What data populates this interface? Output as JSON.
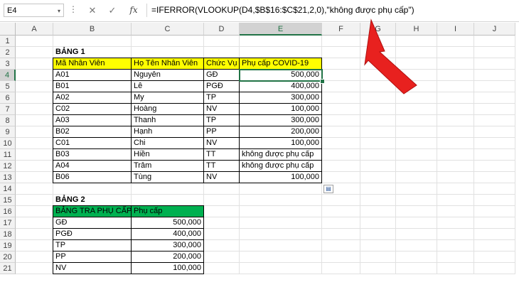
{
  "name_box": "E4",
  "name_box_arrow": "▾",
  "formula_bar": {
    "cancel": "✕",
    "enter": "✓",
    "fx": "fx",
    "formula": "=IFERROR(VLOOKUP(D4,$B$16:$C$21,2,0),\"không được phụ cấp\")"
  },
  "columns": [
    "A",
    "B",
    "C",
    "D",
    "E",
    "F",
    "G",
    "H",
    "I",
    "J"
  ],
  "rows": [
    "1",
    "2",
    "3",
    "4",
    "5",
    "6",
    "7",
    "8",
    "9",
    "10",
    "11",
    "12",
    "13",
    "14",
    "15",
    "16",
    "17",
    "18",
    "19",
    "20",
    "21"
  ],
  "selected_cell": "E4",
  "table1": {
    "title": "BẢNG 1",
    "headers": [
      "Mã Nhân Viên",
      "Họ Tên Nhân Viên",
      "Chức Vụ",
      "Phụ cấp COVID-19"
    ],
    "rows": [
      [
        "A01",
        "Nguyên",
        "GĐ",
        "500,000"
      ],
      [
        "B01",
        "Lê",
        "PGĐ",
        "400,000"
      ],
      [
        "A02",
        "My",
        "TP",
        "300,000"
      ],
      [
        "C02",
        "Hoàng",
        "NV",
        "100,000"
      ],
      [
        "A03",
        "Thanh",
        "TP",
        "300,000"
      ],
      [
        "B02",
        "Hạnh",
        "PP",
        "200,000"
      ],
      [
        "C01",
        "Chi",
        "NV",
        "100,000"
      ],
      [
        "B03",
        "Hiền",
        "TT",
        "không được phụ cấp"
      ],
      [
        "A04",
        "Trâm",
        "TT",
        "không được phụ cấp"
      ],
      [
        "B06",
        "Tùng",
        "NV",
        "100,000"
      ]
    ]
  },
  "table2": {
    "title": "BẢNG 2",
    "headers": [
      "BẢNG TRA PHỤ CẤP",
      "Phụ cấp"
    ],
    "rows": [
      [
        "GĐ",
        "500,000"
      ],
      [
        "PGĐ",
        "400,000"
      ],
      [
        "TP",
        "300,000"
      ],
      [
        "PP",
        "200,000"
      ],
      [
        "NV",
        "100,000"
      ]
    ]
  },
  "colors": {
    "header_yellow": "#ffff00",
    "header_green": "#00b050",
    "selection": "#217346",
    "arrow": "#e02020"
  }
}
